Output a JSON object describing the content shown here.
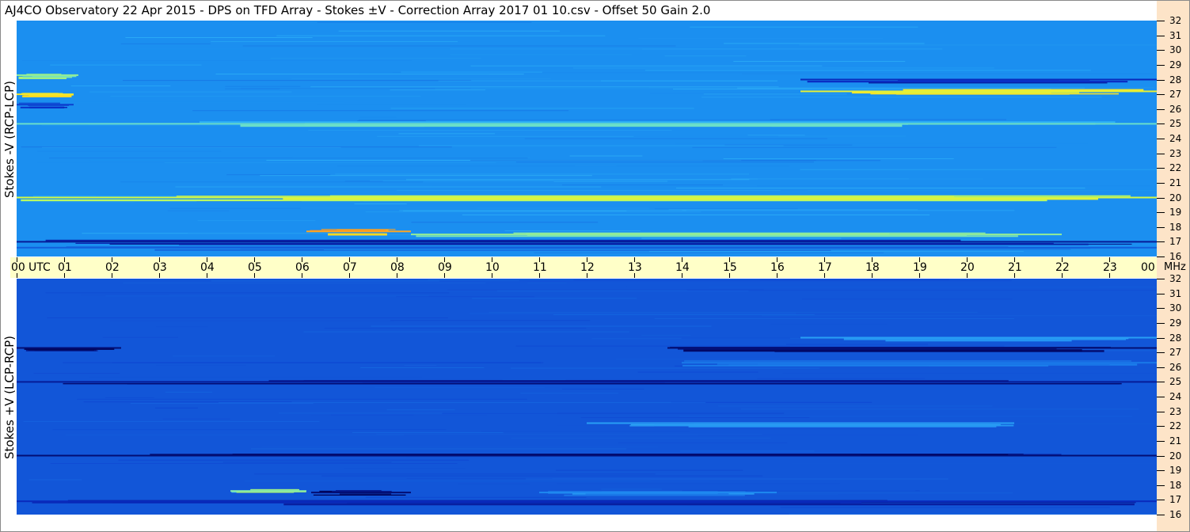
{
  "title": "AJ4CO Observatory  22 Apr 2015  -  DPS on TFD Array  -  Stokes ±V  -  Correction Array 2017 01 10.csv  -  Offset 50  Gain 2.0",
  "colors": {
    "time_bar": "#ffffc8",
    "freq_column": "#fde4c8",
    "top_base": "#1b8ff0",
    "bottom_base": "#1256d8"
  },
  "chart_data": [
    {
      "type": "heatmap",
      "ylabel": "Stokes -V (RCP-LCP)",
      "xlabel": "UTC",
      "x_ticks": [
        "00",
        "01",
        "02",
        "03",
        "04",
        "05",
        "06",
        "07",
        "08",
        "09",
        "10",
        "11",
        "12",
        "13",
        "14",
        "15",
        "16",
        "17",
        "18",
        "19",
        "20",
        "21",
        "22",
        "23",
        "00"
      ],
      "x_range_utc_hours": [
        0,
        24
      ],
      "y_unit": "MHz",
      "y_ticks": [
        "16",
        "17",
        "18",
        "19",
        "20",
        "21",
        "22",
        "23",
        "24",
        "25",
        "26",
        "27",
        "28",
        "29",
        "30",
        "31",
        "32"
      ],
      "y_range_mhz": [
        16,
        32
      ],
      "colormap": [
        "#000050",
        "#0a2fc8",
        "#1b8ff0",
        "#40d0ff",
        "#c8ff50",
        "#ffe020",
        "#ff5020"
      ],
      "bands": [
        {
          "mhz": 27.0,
          "utc_start": 0.0,
          "utc_end": 1.2,
          "level": 0.8
        },
        {
          "mhz": 27.2,
          "utc_start": 16.5,
          "utc_end": 24.0,
          "level": 0.75
        },
        {
          "mhz": 28.0,
          "utc_start": 16.5,
          "utc_end": 24.0,
          "level": 0.15
        },
        {
          "mhz": 28.3,
          "utc_start": 0.0,
          "utc_end": 1.3,
          "level": 0.6
        },
        {
          "mhz": 26.3,
          "utc_start": 0.0,
          "utc_end": 1.2,
          "level": 0.2
        },
        {
          "mhz": 17.7,
          "utc_start": 6.1,
          "utc_end": 8.3,
          "level": 0.9
        },
        {
          "mhz": 17.5,
          "utc_start": 8.3,
          "utc_end": 22.0,
          "level": 0.6
        },
        {
          "mhz": 20.0,
          "utc_start": 0.0,
          "utc_end": 24.0,
          "level": 0.7
        },
        {
          "mhz": 25.0,
          "utc_start": 0.0,
          "utc_end": 24.0,
          "level": 0.55
        },
        {
          "mhz": 17.0,
          "utc_start": 0.0,
          "utc_end": 24.0,
          "level": 0.1
        },
        {
          "mhz": 16.6,
          "utc_start": 0.0,
          "utc_end": 24.0,
          "level": 0.25
        }
      ]
    },
    {
      "type": "heatmap",
      "ylabel": "Stokes +V (LCP-RCP)",
      "xlabel": "UTC",
      "x_ticks": [
        "00",
        "01",
        "02",
        "03",
        "04",
        "05",
        "06",
        "07",
        "08",
        "09",
        "10",
        "11",
        "12",
        "13",
        "14",
        "15",
        "16",
        "17",
        "18",
        "19",
        "20",
        "21",
        "22",
        "23",
        "00"
      ],
      "x_range_utc_hours": [
        0,
        24
      ],
      "y_unit": "MHz",
      "y_ticks": [
        "16",
        "17",
        "18",
        "19",
        "20",
        "21",
        "22",
        "23",
        "24",
        "25",
        "26",
        "27",
        "28",
        "29",
        "30",
        "31",
        "32"
      ],
      "y_range_mhz": [
        16,
        32
      ],
      "colormap": [
        "#000050",
        "#0a2fc8",
        "#1256d8",
        "#1e88f0",
        "#40d0ff",
        "#c8ff50",
        "#ffe020"
      ],
      "bands": [
        {
          "mhz": 27.3,
          "utc_start": 0.0,
          "utc_end": 2.2,
          "level": 0.05
        },
        {
          "mhz": 27.3,
          "utc_start": 13.7,
          "utc_end": 24.0,
          "level": 0.05
        },
        {
          "mhz": 28.0,
          "utc_start": 16.5,
          "utc_end": 24.0,
          "level": 0.55
        },
        {
          "mhz": 26.3,
          "utc_start": 14.0,
          "utc_end": 24.0,
          "level": 0.45
        },
        {
          "mhz": 20.0,
          "utc_start": 0.0,
          "utc_end": 24.0,
          "level": 0.05
        },
        {
          "mhz": 25.0,
          "utc_start": 0.0,
          "utc_end": 24.0,
          "level": 0.1
        },
        {
          "mhz": 17.6,
          "utc_start": 4.5,
          "utc_end": 6.1,
          "level": 0.75
        },
        {
          "mhz": 17.5,
          "utc_start": 6.2,
          "utc_end": 8.3,
          "level": 0.05
        },
        {
          "mhz": 17.5,
          "utc_start": 11.0,
          "utc_end": 16.0,
          "level": 0.5
        },
        {
          "mhz": 16.9,
          "utc_start": 0.0,
          "utc_end": 24.0,
          "level": 0.15
        },
        {
          "mhz": 22.2,
          "utc_start": 12.0,
          "utc_end": 21.0,
          "level": 0.55
        }
      ]
    }
  ],
  "mhz_label": "MHz"
}
